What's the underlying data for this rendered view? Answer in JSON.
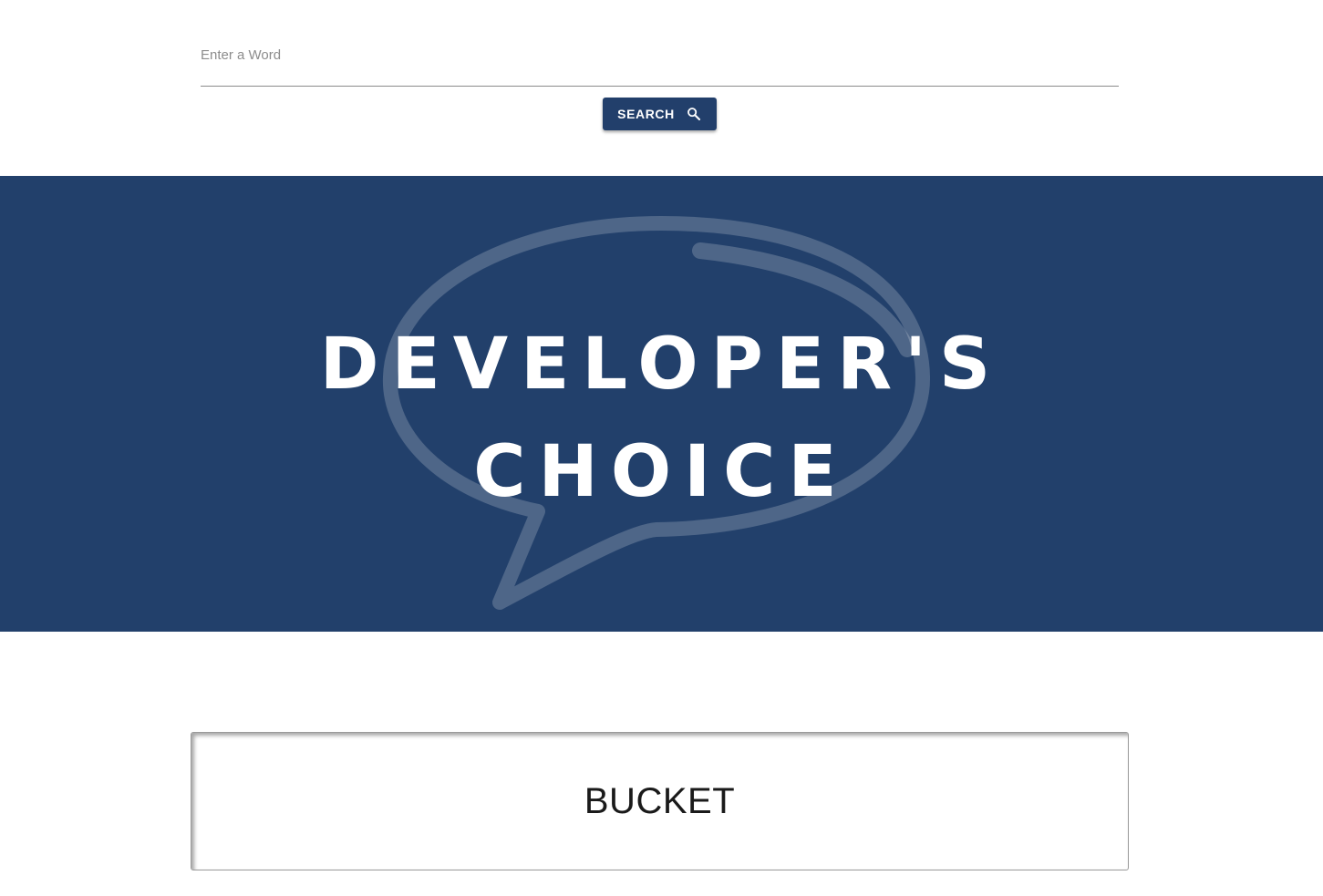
{
  "search": {
    "placeholder": "Enter a Word",
    "value": "",
    "button_label": "SEARCH",
    "button_icon": "search-icon"
  },
  "banner": {
    "logo_line1": "DEVELOPER'S",
    "logo_line2": "CHOICE",
    "logo_icon": "speech-bubble-icon"
  },
  "result": {
    "word": "BUCKET"
  },
  "colors": {
    "brand_navy": "#223f6b",
    "banner_bg": "#22406b",
    "page_bg": "#ffffff"
  }
}
